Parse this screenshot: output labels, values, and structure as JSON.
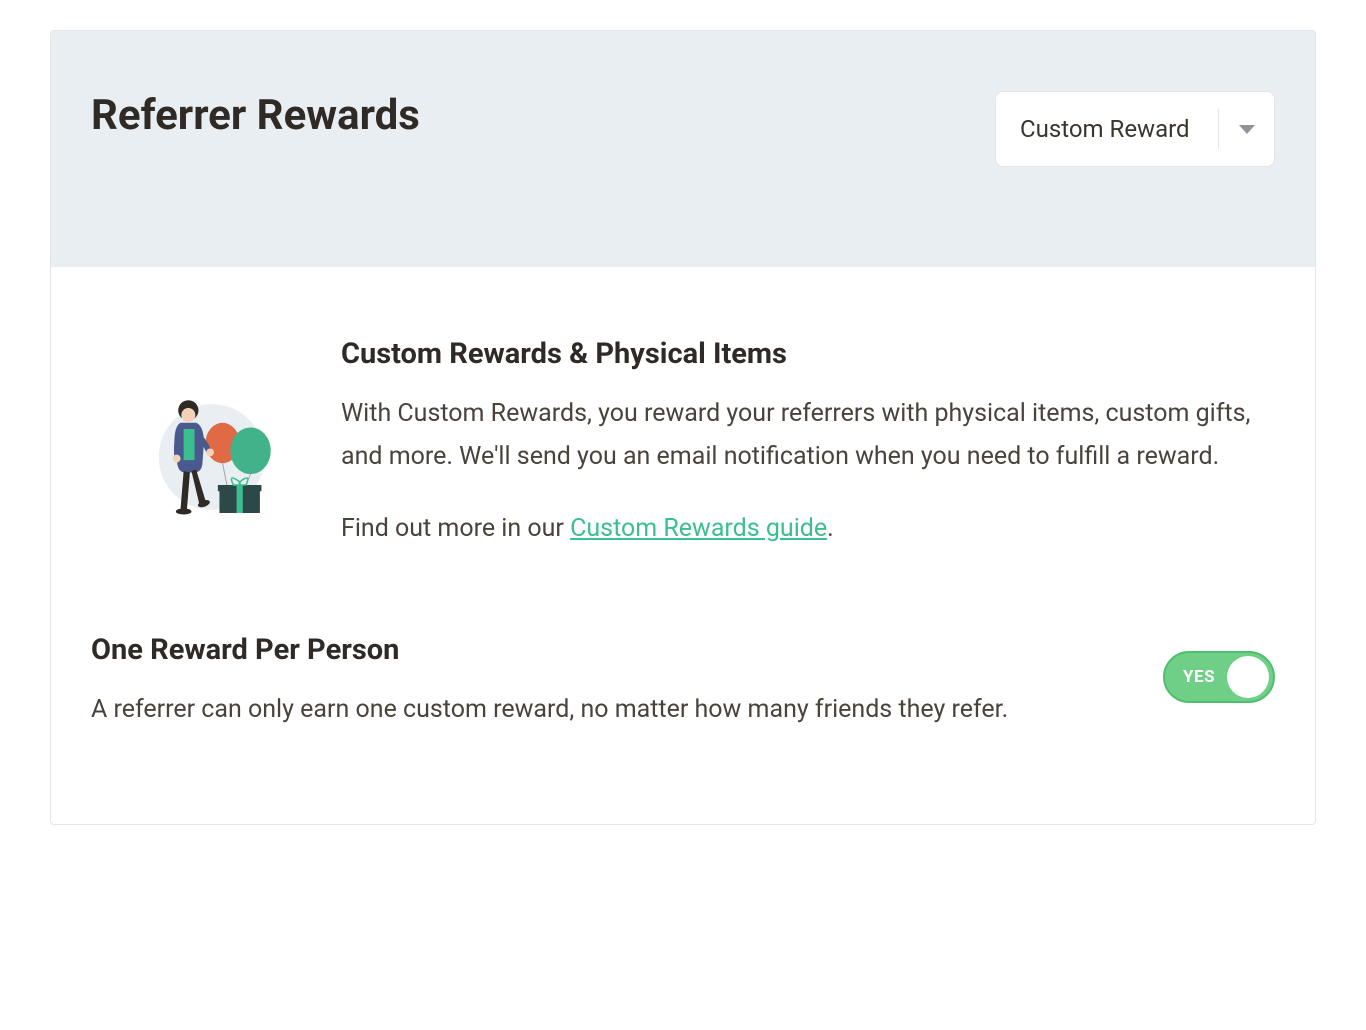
{
  "header": {
    "title": "Referrer Rewards",
    "select": {
      "selected": "Custom Reward"
    }
  },
  "intro": {
    "heading": "Custom Rewards & Physical Items",
    "description": "With Custom Rewards, you reward your referrers with physical items, custom gifts, and more. We'll send you an email notification when you need to fulfill a reward.",
    "link_prefix": "Find out more in our ",
    "link_text": "Custom Rewards guide",
    "link_suffix": "."
  },
  "setting": {
    "heading": "One Reward Per Person",
    "description": "A referrer can only earn one custom reward, no matter how many friends they refer.",
    "toggle_state": "YES"
  }
}
